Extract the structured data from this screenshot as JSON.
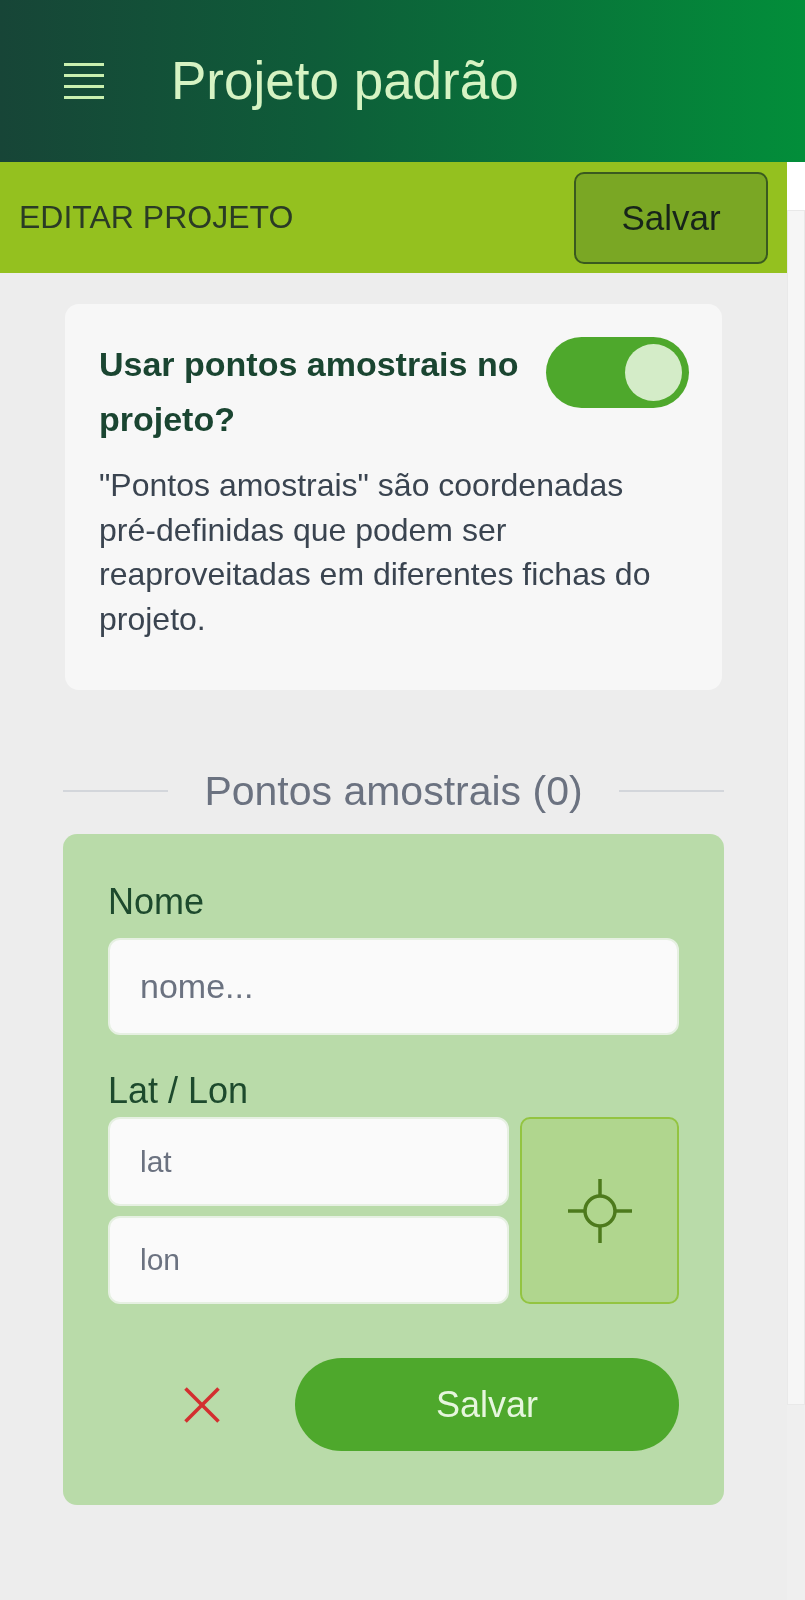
{
  "app_bar": {
    "title": "Projeto padrão"
  },
  "toolbar": {
    "title": "EDITAR PROJETO",
    "save_button": "Salvar"
  },
  "settings_card": {
    "title": "Usar pontos amostrais no projeto?",
    "toggle": {
      "on": true
    },
    "description": "\"Pontos amostrais\" são coordenadas pré-definidas que podem ser reaproveitadas em diferentes fichas do projeto."
  },
  "sample_points": {
    "heading": "Pontos amostrais (0)"
  },
  "point_form": {
    "name_field": {
      "label": "Nome",
      "placeholder": "nome..."
    },
    "coordinates": {
      "label": "Lat / Lon",
      "lat_placeholder": "lat",
      "lon_placeholder": "lon"
    },
    "save_button": "Salvar"
  }
}
